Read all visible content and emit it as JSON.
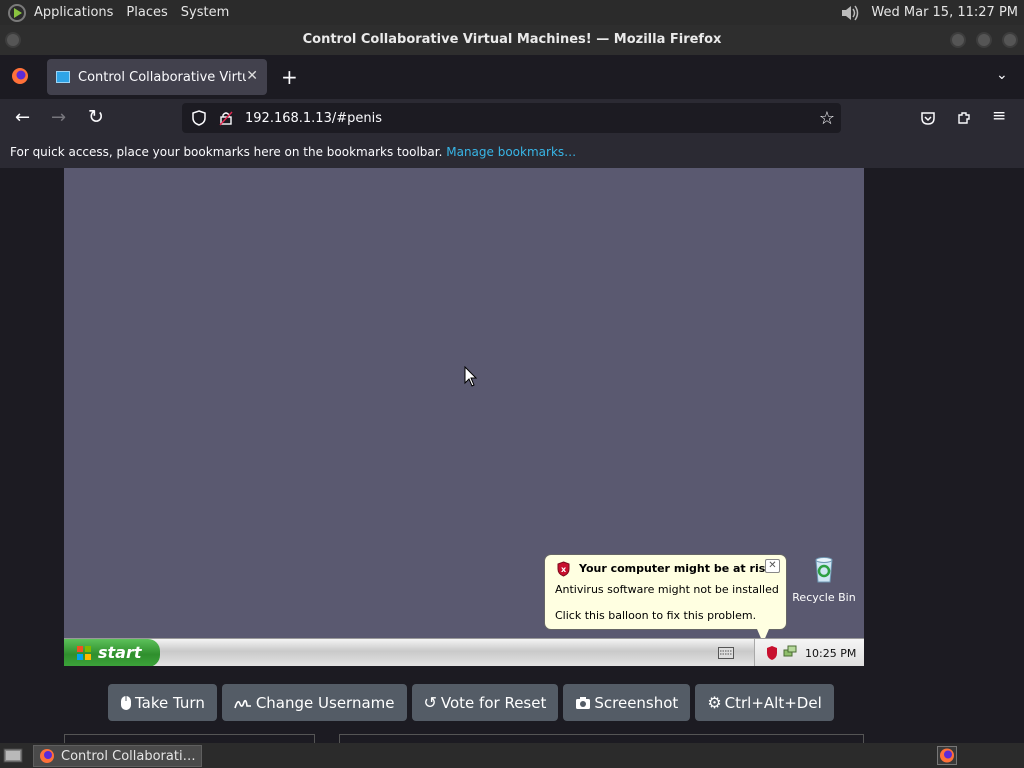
{
  "desktop_panel": {
    "menus": [
      "Applications",
      "Places",
      "System"
    ],
    "clock": "Wed Mar 15, 11:27 PM"
  },
  "window": {
    "title": "Control Collaborative Virtual Machines! — Mozilla Firefox"
  },
  "tab": {
    "title": "Control Collaborative Virtua"
  },
  "address_bar": {
    "url": "192.168.1.13/#penis"
  },
  "bookmarks_bar": {
    "text": "For quick access, place your bookmarks here on the bookmarks toolbar.",
    "link": "Manage bookmarks…"
  },
  "vm": {
    "start_label": "start",
    "tray_time": "10:25 PM",
    "recycle_bin_label": "Recycle Bin",
    "balloon": {
      "title": "Your computer might be at risk",
      "line1": "Antivirus software might not be installed",
      "line2": "Click this balloon to fix this problem."
    }
  },
  "controls": {
    "take_turn": "Take Turn",
    "change_username": "Change Username",
    "vote_reset": "Vote for Reset",
    "screenshot": "Screenshot",
    "ctrl_alt_del": "Ctrl+Alt+Del"
  },
  "taskbar": {
    "window_item": "Control Collaborati…"
  }
}
